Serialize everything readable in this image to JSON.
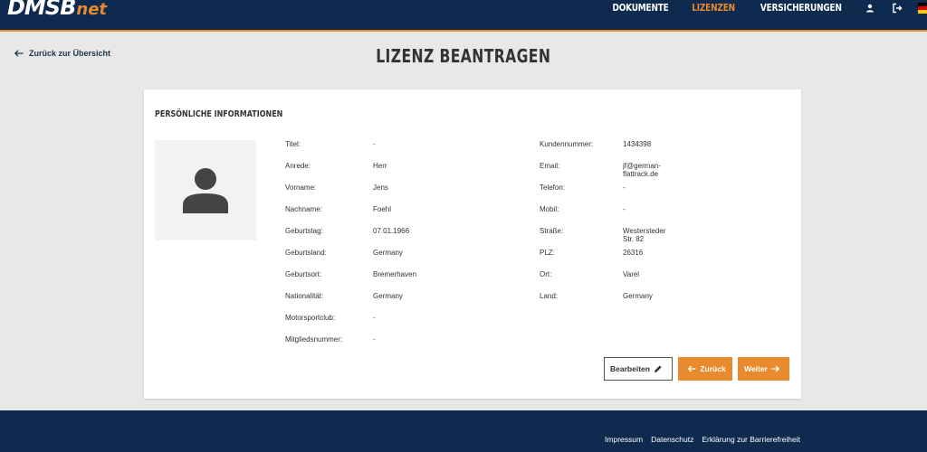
{
  "header": {
    "logo_main": "DMSB",
    "logo_sub": "net",
    "nav": [
      {
        "label": "DOKUMENTE",
        "active": false
      },
      {
        "label": "LIZENZEN",
        "active": true
      },
      {
        "label": "VERSICHERUNGEN",
        "active": false
      }
    ],
    "icons": [
      "user-icon",
      "logout-icon",
      "german-flag-icon"
    ],
    "colors": {
      "navy": "#0e2a4f",
      "accent": "#e98a2e"
    }
  },
  "back_link": "Zurück zur Übersicht",
  "page_title": "LIZENZ BEANTRAGEN",
  "section_title": "PERSÖNLICHE INFORMATIONEN",
  "left_fields": [
    {
      "label": "Titel:",
      "value": "-"
    },
    {
      "label": "Anrede:",
      "value": "Herr"
    },
    {
      "label": "Vorname:",
      "value": "Jens"
    },
    {
      "label": "Nachname:",
      "value": "Foehl"
    },
    {
      "label": "Geburtstag:",
      "value": "07.01.1966"
    },
    {
      "label": "Geburtsland:",
      "value": "Germany"
    },
    {
      "label": "Geburtsort:",
      "value": "Bremerhaven"
    },
    {
      "label": "Nationalität:",
      "value": "Germany"
    },
    {
      "label": "Motorsportclub:",
      "value": "-"
    },
    {
      "label": "Mitgliedsnummer:",
      "value": "-"
    }
  ],
  "right_fields": [
    {
      "label": "Kundennummer:",
      "value": "1434398"
    },
    {
      "label": "Email:",
      "value": "jf@german-flattrack.de"
    },
    {
      "label": "Telefon:",
      "value": "-"
    },
    {
      "label": "Mobil:",
      "value": "-"
    },
    {
      "label": "Straße:",
      "value": "Westersteder Str. 82"
    },
    {
      "label": "PLZ:",
      "value": "26316"
    },
    {
      "label": "Ort:",
      "value": "Varel"
    },
    {
      "label": "Land:",
      "value": "Germany"
    }
  ],
  "buttons": {
    "edit": "Bearbeiten",
    "back": "Zurück",
    "next": "Weiter"
  },
  "footer": {
    "links": [
      "Impressum",
      "Datenschutz",
      "Erklärung zur Barrierefreiheit"
    ]
  }
}
